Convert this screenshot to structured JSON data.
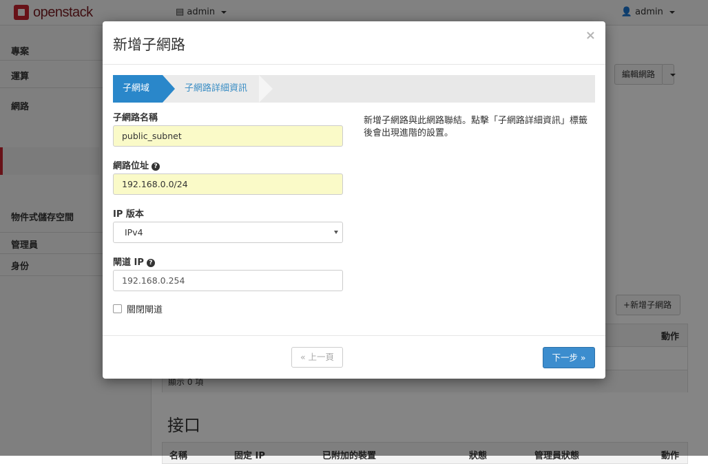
{
  "topbar": {
    "logo_text": "openstack",
    "project_menu": "admin",
    "user_menu": "admin"
  },
  "sidebar": {
    "items": [
      {
        "label": "專案"
      },
      {
        "label": "運算"
      },
      {
        "label": "網路"
      },
      {
        "label": "物件式儲存空間"
      },
      {
        "label": "管理員"
      },
      {
        "label": "身份"
      }
    ]
  },
  "background": {
    "edit_network_button": "編輯網路",
    "add_subnet_button": "新增子網路",
    "subnet_table_action_header": "動作",
    "subnet_table_count": "顯示 0 項",
    "interfaces_heading": "接口",
    "interfaces_columns": [
      "名稱",
      "固定 IP",
      "已附加的裝置",
      "狀態",
      "管理員狀態",
      "動作"
    ]
  },
  "modal": {
    "title": "新增子網路",
    "close": "×",
    "steps": [
      {
        "label": "子網域",
        "active": true
      },
      {
        "label": "子網路詳細資訊",
        "active": false
      }
    ],
    "fields": {
      "subnet_name": {
        "label": "子網路名稱",
        "value": "public_subnet"
      },
      "network_address": {
        "label": "網路位址",
        "value": "192.168.0.0/24"
      },
      "ip_version": {
        "label": "IP 版本",
        "value": "IPv4"
      },
      "gateway_ip": {
        "label": "閘道 IP",
        "value": "192.168.0.254"
      },
      "disable_gateway": {
        "label": "關閉閘道",
        "checked": false
      }
    },
    "help_text": "新增子網路與此網路聯結。點擊「子網路詳細資訊」標籤後會出現進階的設置。",
    "buttons": {
      "back": "« 上一頁",
      "next": "下一步 »"
    }
  },
  "colors": {
    "brand": "#c7232f",
    "primary": "#3c8dce",
    "filled_input": "#fafac8"
  }
}
